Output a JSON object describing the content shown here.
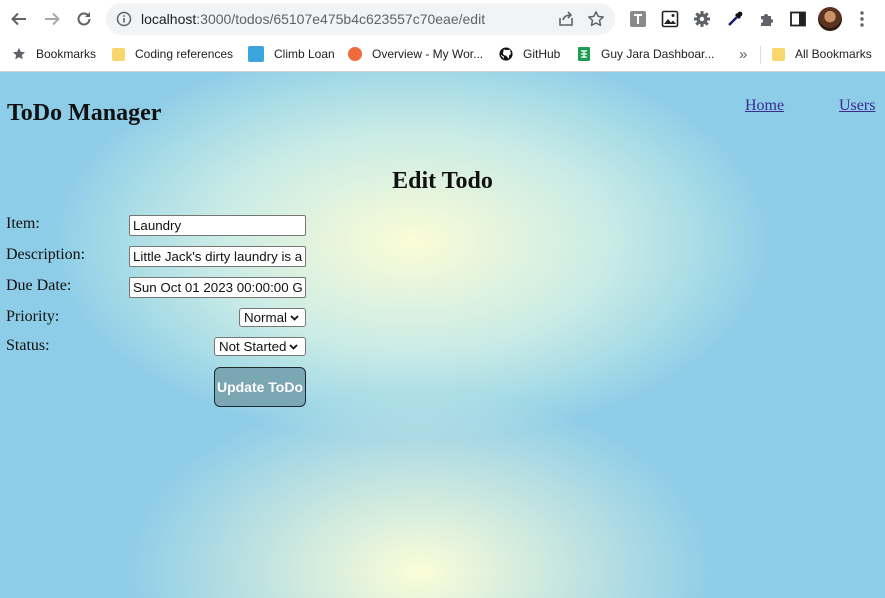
{
  "browser": {
    "url_host": "localhost",
    "url_path": ":3000/todos/65107e475b4c623557c70eae/edit",
    "bookmarks": [
      {
        "label": "Bookmarks"
      },
      {
        "label": "Coding references"
      },
      {
        "label": "Climb Loan"
      },
      {
        "label": "Overview - My Wor..."
      },
      {
        "label": "GitHub"
      },
      {
        "label": "Guy Jara Dashboar..."
      },
      {
        "label": "All Bookmarks"
      }
    ],
    "overflow_label": "»"
  },
  "app": {
    "title": "ToDo Manager",
    "nav": {
      "home": "Home",
      "users": "Users"
    }
  },
  "form": {
    "heading": "Edit Todo",
    "item_label": "Item:",
    "item_value": "Laundry",
    "description_label": "Description:",
    "description_value": "Little Jack's dirty laundry is a",
    "due_label": "Due Date:",
    "due_value": "Sun Oct 01 2023 00:00:00 G",
    "priority_label": "Priority:",
    "priority_value": "Normal",
    "status_label": "Status:",
    "status_value": "Not Started",
    "submit_label": "Update ToDo"
  }
}
